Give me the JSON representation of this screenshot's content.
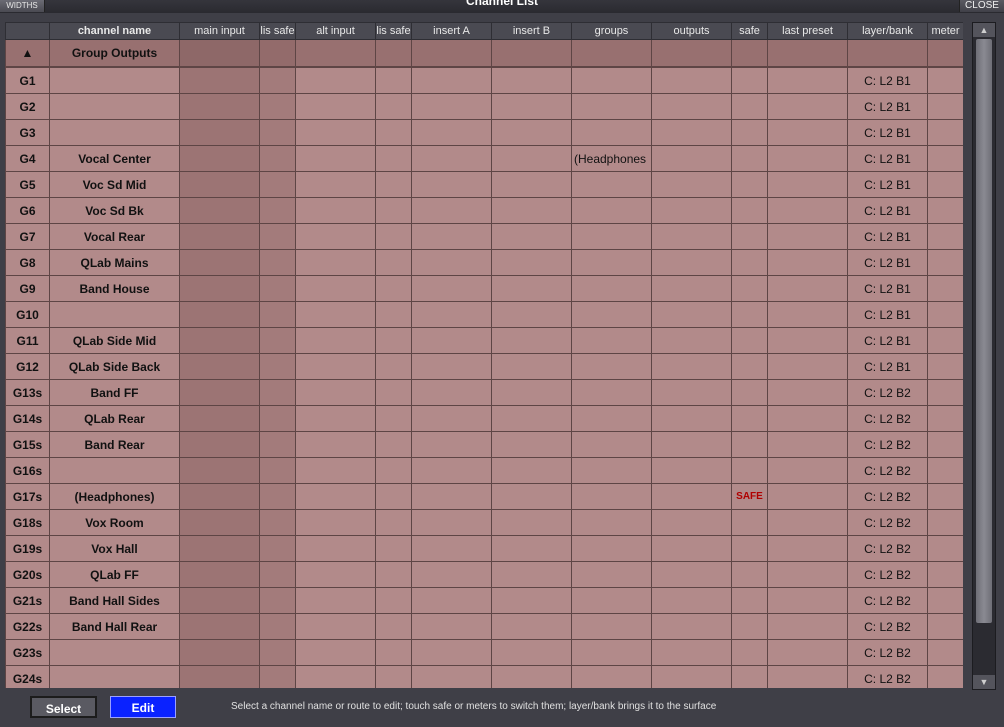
{
  "window": {
    "title": "Channel List",
    "widths_label": "WIDTHS",
    "close_label": "CLOSE"
  },
  "columns": [
    "",
    "channel name",
    "main input",
    "lis safe",
    "alt input",
    "lis safe",
    "insert A",
    "insert B",
    "groups",
    "outputs",
    "safe",
    "last preset",
    "layer/bank",
    "meter"
  ],
  "group_header": {
    "icon": "eject-icon",
    "glyph": "▲",
    "label": "Group Outputs"
  },
  "rows": [
    {
      "id": "G1",
      "name": "",
      "groups": "",
      "safe": "",
      "layer_bank": "C: L2 B1"
    },
    {
      "id": "G2",
      "name": "",
      "groups": "",
      "safe": "",
      "layer_bank": "C: L2 B1"
    },
    {
      "id": "G3",
      "name": "",
      "groups": "",
      "safe": "",
      "layer_bank": "C: L2 B1"
    },
    {
      "id": "G4",
      "name": "Vocal Center",
      "groups": "(Headphones",
      "safe": "",
      "layer_bank": "C: L2 B1"
    },
    {
      "id": "G5",
      "name": "Voc Sd Mid",
      "groups": "",
      "safe": "",
      "layer_bank": "C: L2 B1"
    },
    {
      "id": "G6",
      "name": "Voc Sd Bk",
      "groups": "",
      "safe": "",
      "layer_bank": "C: L2 B1"
    },
    {
      "id": "G7",
      "name": "Vocal Rear",
      "groups": "",
      "safe": "",
      "layer_bank": "C: L2 B1"
    },
    {
      "id": "G8",
      "name": "QLab Mains",
      "groups": "",
      "safe": "",
      "layer_bank": "C: L2 B1"
    },
    {
      "id": "G9",
      "name": "Band House",
      "groups": "",
      "safe": "",
      "layer_bank": "C: L2 B1"
    },
    {
      "id": "G10",
      "name": "",
      "groups": "",
      "safe": "",
      "layer_bank": "C: L2 B1"
    },
    {
      "id": "G11",
      "name": "QLab Side Mid",
      "groups": "",
      "safe": "",
      "layer_bank": "C: L2 B1"
    },
    {
      "id": "G12",
      "name": "QLab Side Back",
      "groups": "",
      "safe": "",
      "layer_bank": "C: L2 B1"
    },
    {
      "id": "G13s",
      "name": "Band FF",
      "groups": "",
      "safe": "",
      "layer_bank": "C: L2 B2"
    },
    {
      "id": "G14s",
      "name": "QLab Rear",
      "groups": "",
      "safe": "",
      "layer_bank": "C: L2 B2"
    },
    {
      "id": "G15s",
      "name": "Band Rear",
      "groups": "",
      "safe": "",
      "layer_bank": "C: L2 B2"
    },
    {
      "id": "G16s",
      "name": "",
      "groups": "",
      "safe": "",
      "layer_bank": "C: L2 B2"
    },
    {
      "id": "G17s",
      "name": "(Headphones)",
      "groups": "",
      "safe": "SAFE",
      "layer_bank": "C: L2 B2"
    },
    {
      "id": "G18s",
      "name": "Vox Room",
      "groups": "",
      "safe": "",
      "layer_bank": "C: L2 B2"
    },
    {
      "id": "G19s",
      "name": "Vox Hall",
      "groups": "",
      "safe": "",
      "layer_bank": "C: L2 B2"
    },
    {
      "id": "G20s",
      "name": "QLab FF",
      "groups": "",
      "safe": "",
      "layer_bank": "C: L2 B2"
    },
    {
      "id": "G21s",
      "name": "Band Hall Sides",
      "groups": "",
      "safe": "",
      "layer_bank": "C: L2 B2"
    },
    {
      "id": "G22s",
      "name": "Band Hall Rear",
      "groups": "",
      "safe": "",
      "layer_bank": "C: L2 B2"
    },
    {
      "id": "G23s",
      "name": "",
      "groups": "",
      "safe": "",
      "layer_bank": "C: L2 B2"
    },
    {
      "id": "G24s",
      "name": "",
      "groups": "",
      "safe": "",
      "layer_bank": "C: L2 B2"
    }
  ],
  "footer": {
    "select_label": "Select",
    "edit_label": "Edit",
    "hint": "Select a channel name or route to edit; touch safe or meters to switch them; layer/bank brings it to the surface"
  },
  "colors": {
    "cell": "#b28a8a",
    "main_input_col": "#9c7474",
    "safe_text": "#b00000",
    "edit_button": "#0a22ff"
  }
}
